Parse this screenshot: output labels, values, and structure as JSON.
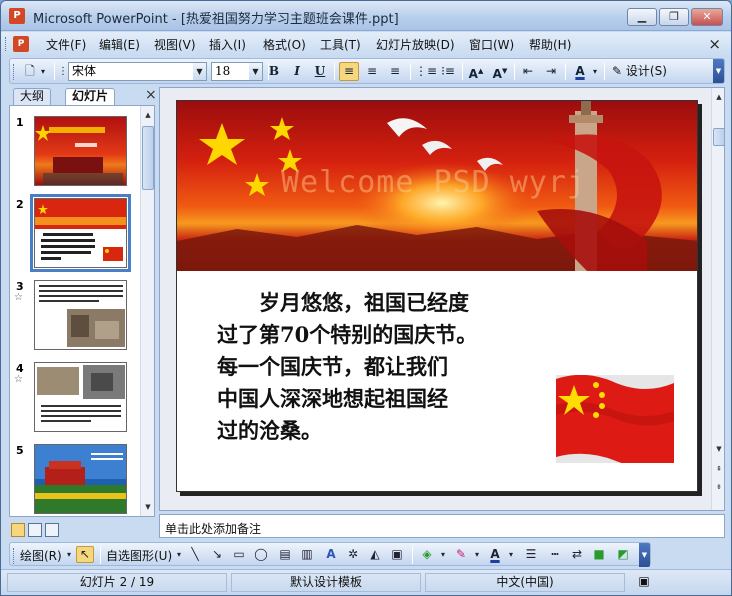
{
  "window": {
    "app_icon": "powerpoint-icon",
    "title": "Microsoft PowerPoint - [热爱祖国努力学习主题班会课件.ppt]",
    "controls": [
      "minimize",
      "restore",
      "close"
    ]
  },
  "menu": {
    "items": [
      "文件(F)",
      "编辑(E)",
      "视图(V)",
      "插入(I)",
      "格式(O)",
      "工具(T)",
      "幻灯片放映(D)",
      "窗口(W)",
      "帮助(H)"
    ],
    "close_glyph": "×"
  },
  "format_toolbar": {
    "font_name": "宋体",
    "font_size": "18",
    "bold": "B",
    "italic": "I",
    "underline": "U",
    "design_label": "设计(S)",
    "align_left_active": true
  },
  "left_pane": {
    "tabs": [
      "大纲",
      "幻灯片"
    ],
    "active_tab": "幻灯片",
    "close_glyph": "×",
    "slides": [
      {
        "number": "1",
        "has_animation": false,
        "selected": false
      },
      {
        "number": "2",
        "has_animation": false,
        "selected": true
      },
      {
        "number": "3",
        "has_animation": true,
        "selected": false
      },
      {
        "number": "4",
        "has_animation": true,
        "selected": false
      },
      {
        "number": "5",
        "has_animation": false,
        "selected": false
      }
    ]
  },
  "slide": {
    "watermark": "Welcome PSD wyrj",
    "body_lines": [
      "岁月悠悠，祖国已经度",
      "过了第70个特别的国庆节。",
      "每一个国庆节，都让我们",
      "中国人深深地想起祖国经",
      "过的沧桑。"
    ]
  },
  "notes": {
    "placeholder": "单击此处添加备注"
  },
  "drawing_toolbar": {
    "draw_label": "绘图(R)",
    "autoshape_label": "自选图形(U)"
  },
  "status": {
    "slide_position": "幻灯片 2 / 19",
    "design_template": "默认设计模板",
    "language": "中文(中国)"
  },
  "colors": {
    "chrome_blue": "#c9dbf1",
    "banner_red": "#d4200f",
    "highlight": "#f7d77d"
  }
}
